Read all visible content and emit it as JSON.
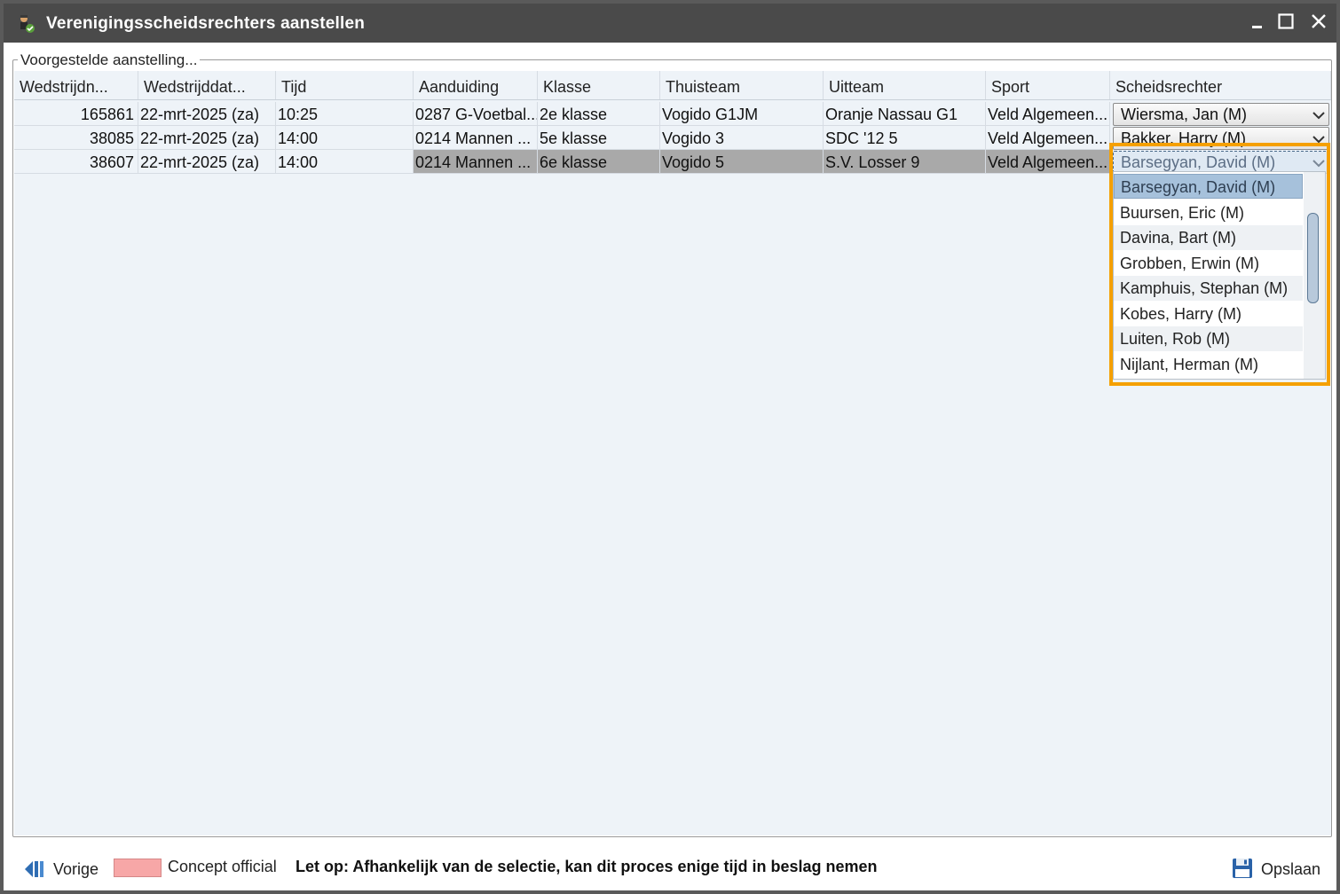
{
  "window": {
    "title": "Verenigingsscheidsrechters aanstellen",
    "minimize_glyph": "—",
    "maximize_glyph": "☐",
    "close_glyph": "✕"
  },
  "group": {
    "legend": "Voorgestelde aanstelling..."
  },
  "columns": [
    "Wedstrijdn...",
    "Wedstrijddat...",
    "Tijd",
    "Aanduiding",
    "Klasse",
    "Thuisteam",
    "Uitteam",
    "Sport",
    "Scheidsrechter"
  ],
  "rows": [
    {
      "nummer": "165861",
      "datum": "22-mrt-2025 (za)",
      "tijd": "10:25",
      "aanduiding": "0287 G-Voetbal...",
      "klasse": "2e klasse",
      "thuisteam": "Vogido G1JM",
      "uitteam": "Oranje Nassau G1",
      "sport": "Veld Algemeen...",
      "scheidsrechter": "Wiersma, Jan (M)",
      "selected": false
    },
    {
      "nummer": "38085",
      "datum": "22-mrt-2025 (za)",
      "tijd": "14:00",
      "aanduiding": "0214 Mannen ...",
      "klasse": "5e klasse",
      "thuisteam": "Vogido 3",
      "uitteam": "SDC '12 5",
      "sport": "Veld Algemeen...",
      "scheidsrechter": "Bakker, Harry (M)",
      "selected": false
    },
    {
      "nummer": "38607",
      "datum": "22-mrt-2025 (za)",
      "tijd": "14:00",
      "aanduiding": "0214 Mannen ...",
      "klasse": "6e klasse",
      "thuisteam": "Vogido 5",
      "uitteam": "S.V. Losser 9",
      "sport": "Veld Algemeen...",
      "scheidsrechter": "Barsegyan, David (M)",
      "selected": true
    }
  ],
  "dropdown": {
    "options": [
      "Barsegyan, David (M)",
      "Buursen, Eric (M)",
      "Davina, Bart (M)",
      "Grobben, Erwin (M)",
      "Kamphuis, Stephan (M)",
      "Kobes, Harry (M)",
      "Luiten, Rob (M)",
      "Nijlant, Herman (M)"
    ],
    "selected_index": 0
  },
  "footer": {
    "back_label": "Vorige",
    "legend_label": "Concept official",
    "legend_color": "#f7a7a7",
    "notice": "Let op: Afhankelijk van de selectie, kan dit proces enige tijd in beslag nemen",
    "save_label": "Opslaan"
  },
  "icons": {
    "app": "referee-icon",
    "back": "back-arrow-icon",
    "save": "floppy-disk-icon",
    "combo": "chevron-down-icon"
  },
  "colors": {
    "titlebar": "#4a4a4a",
    "grid_bg": "#eef3f8",
    "selected_row": "#a9a9a9",
    "dropdown_selected": "#a6c1db",
    "highlight_frame": "#f5a000"
  }
}
